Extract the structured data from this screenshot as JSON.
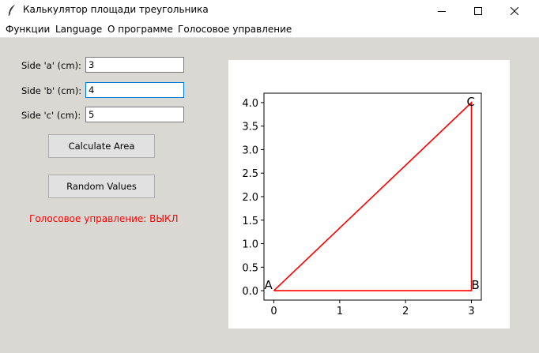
{
  "window": {
    "title": "Калькулятор площади треугольника",
    "icon": "feather-icon",
    "controls": [
      "minimize-icon",
      "maximize-icon",
      "close-icon"
    ]
  },
  "menu": {
    "items": [
      "Функции",
      "Language",
      "О программе",
      "Голосовое управление"
    ]
  },
  "form": {
    "side_a": {
      "label": "Side 'a' (cm):",
      "value": "3"
    },
    "side_b": {
      "label": "Side 'b' (cm):",
      "value": "4"
    },
    "side_c": {
      "label": "Side 'c' (cm):",
      "value": "5"
    }
  },
  "buttons": {
    "calculate": "Calculate Area",
    "random": "Random Values"
  },
  "status": {
    "voice": "Голосовое управление: ВЫКЛ",
    "color": "#ff0000"
  },
  "chart_data": {
    "type": "line",
    "series": [
      {
        "x": [
          0,
          3,
          3,
          0
        ],
        "y": [
          0,
          0,
          4,
          0
        ],
        "color": "#ff0000"
      }
    ],
    "vertices": [
      {
        "label": "A",
        "x": 0,
        "y": 0
      },
      {
        "label": "B",
        "x": 3,
        "y": 0
      },
      {
        "label": "C",
        "x": 3,
        "y": 4
      }
    ],
    "xticks": [
      "0",
      "1",
      "2",
      "3"
    ],
    "xtick_values": [
      0,
      1,
      2,
      3
    ],
    "yticks": [
      "0.0",
      "0.5",
      "1.0",
      "1.5",
      "2.0",
      "2.5",
      "3.0",
      "3.5",
      "4.0"
    ],
    "ytick_values": [
      0,
      0.5,
      1,
      1.5,
      2,
      2.5,
      3,
      3.5,
      4
    ],
    "xlim": [
      -0.15,
      3.15
    ],
    "ylim": [
      -0.2,
      4.2
    ],
    "grid": false,
    "title": "",
    "xlabel": "",
    "ylabel": ""
  }
}
